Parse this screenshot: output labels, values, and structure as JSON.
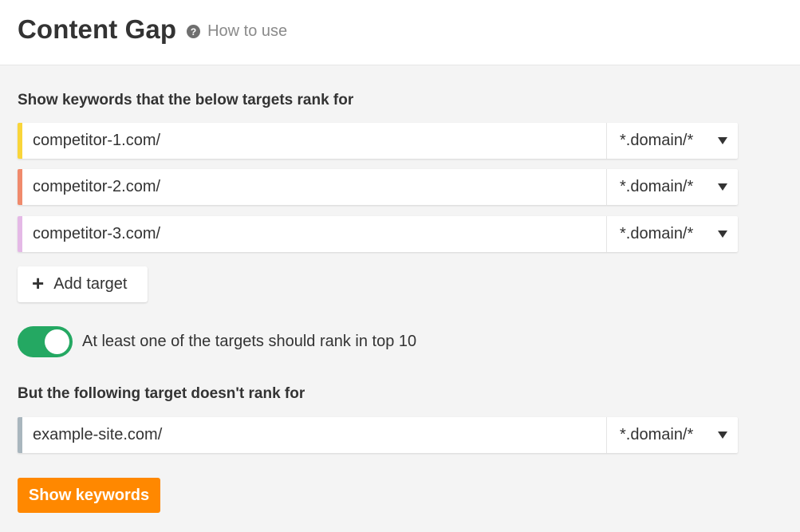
{
  "header": {
    "title": "Content Gap",
    "help_icon": "question-circle-icon",
    "help_glyph": "?",
    "how_to_use": "How to use"
  },
  "include_section": {
    "title": "Show keywords that the below targets rank for",
    "targets": [
      {
        "value": "competitor-1.com/",
        "mode": "*.domain/*",
        "color": "#f9d53a"
      },
      {
        "value": "competitor-2.com/",
        "mode": "*.domain/*",
        "color": "#f08a6c"
      },
      {
        "value": "competitor-3.com/",
        "mode": "*.domain/*",
        "color": "#e4b9e6"
      }
    ],
    "add_target_label": "Add target",
    "add_target_icon": "plus-icon",
    "add_target_glyph": "+"
  },
  "toggle": {
    "on": true,
    "label": "At least one of the targets should rank in top 10",
    "color": "#24a862"
  },
  "exclude_section": {
    "title": "But the following target doesn't rank for",
    "target": {
      "value": "example-site.com/",
      "mode": "*.domain/*",
      "color": "#a9b6be"
    }
  },
  "submit": {
    "label": "Show keywords",
    "color": "#ff8800"
  }
}
